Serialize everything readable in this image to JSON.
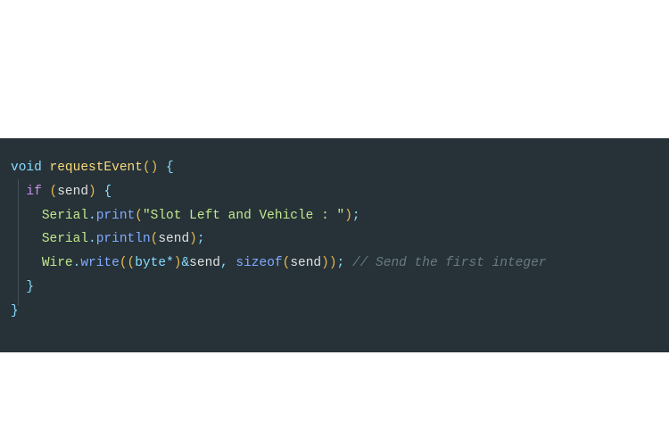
{
  "code": {
    "lines": [
      {
        "indent": "",
        "tokens": [
          {
            "cls": "type",
            "text": "void"
          },
          {
            "cls": "",
            "text": " "
          },
          {
            "cls": "fn-name",
            "text": "requestEvent"
          },
          {
            "cls": "paren",
            "text": "()"
          },
          {
            "cls": "",
            "text": " "
          },
          {
            "cls": "punct",
            "text": "{"
          }
        ]
      },
      {
        "indent": "  ",
        "tokens": [
          {
            "cls": "kw",
            "text": "if"
          },
          {
            "cls": "",
            "text": " "
          },
          {
            "cls": "paren",
            "text": "("
          },
          {
            "cls": "ident",
            "text": "send"
          },
          {
            "cls": "paren",
            "text": ")"
          },
          {
            "cls": "",
            "text": " "
          },
          {
            "cls": "punct",
            "text": "{"
          }
        ]
      },
      {
        "indent": "    ",
        "tokens": [
          {
            "cls": "obj",
            "text": "Serial"
          },
          {
            "cls": "punct",
            "text": "."
          },
          {
            "cls": "fn-call",
            "text": "print"
          },
          {
            "cls": "paren",
            "text": "("
          },
          {
            "cls": "str",
            "text": "\"Slot Left and Vehicle : \""
          },
          {
            "cls": "paren",
            "text": ")"
          },
          {
            "cls": "punct",
            "text": ";"
          }
        ]
      },
      {
        "indent": "    ",
        "tokens": [
          {
            "cls": "obj",
            "text": "Serial"
          },
          {
            "cls": "punct",
            "text": "."
          },
          {
            "cls": "fn-call",
            "text": "println"
          },
          {
            "cls": "paren",
            "text": "("
          },
          {
            "cls": "ident",
            "text": "send"
          },
          {
            "cls": "paren",
            "text": ")"
          },
          {
            "cls": "punct",
            "text": ";"
          }
        ]
      },
      {
        "indent": "    ",
        "tokens": [
          {
            "cls": "obj",
            "text": "Wire"
          },
          {
            "cls": "punct",
            "text": "."
          },
          {
            "cls": "fn-call",
            "text": "write"
          },
          {
            "cls": "paren",
            "text": "(("
          },
          {
            "cls": "type",
            "text": "byte"
          },
          {
            "cls": "op",
            "text": "*"
          },
          {
            "cls": "paren",
            "text": ")"
          },
          {
            "cls": "op",
            "text": "&"
          },
          {
            "cls": "ident",
            "text": "send"
          },
          {
            "cls": "punct",
            "text": ","
          },
          {
            "cls": "",
            "text": " "
          },
          {
            "cls": "fn-call",
            "text": "sizeof"
          },
          {
            "cls": "paren",
            "text": "("
          },
          {
            "cls": "ident",
            "text": "send"
          },
          {
            "cls": "paren",
            "text": "))"
          },
          {
            "cls": "punct",
            "text": ";"
          },
          {
            "cls": "",
            "text": " "
          },
          {
            "cls": "comment",
            "text": "// Send the first integer"
          }
        ]
      },
      {
        "indent": "  ",
        "tokens": [
          {
            "cls": "punct",
            "text": "}"
          }
        ]
      },
      {
        "indent": "",
        "tokens": [
          {
            "cls": "punct",
            "text": "}"
          }
        ]
      }
    ]
  }
}
